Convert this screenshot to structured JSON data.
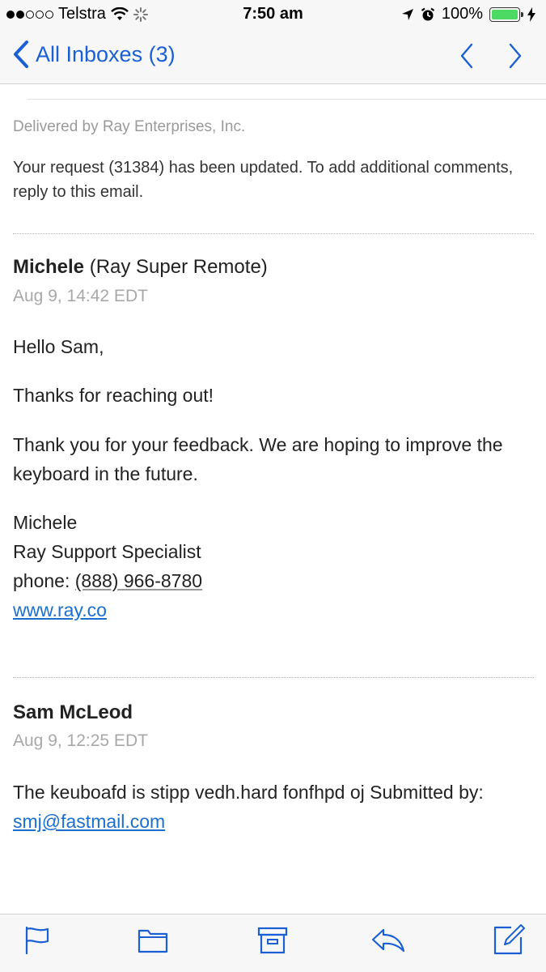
{
  "status_bar": {
    "carrier": "Telstra",
    "time": "7:50 am",
    "battery": "100%"
  },
  "nav": {
    "back_label": "All Inboxes (3)"
  },
  "email": {
    "delivered_by": "Delivered by Ray Enterprises, Inc.",
    "intro": "Your request (31384) has been updated. To add additional comments, reply to this email."
  },
  "messages": [
    {
      "sender_name": "Michele",
      "sender_org": "(Ray Super Remote)",
      "date": "Aug 9, 14:42 EDT",
      "greeting": "Hello Sam,",
      "line1": "Thanks for reaching out!",
      "line2": "Thank you for your feedback. We are hoping to improve the keyboard in the future.",
      "signature_name": "Michele",
      "signature_title": "Ray Support Specialist",
      "phone_label": "phone:",
      "phone": "(888) 966-8780",
      "website": "www.ray.co"
    },
    {
      "sender_name": "Sam McLeod",
      "date": "Aug 9, 12:25 EDT",
      "body_prefix": "The keuboafd is stipp vedh.hard fonfhpd oj Submitted by:",
      "email_link": "smj@fastmail.com"
    }
  ],
  "colors": {
    "accent": "#1a5fd3",
    "link": "#1a6fd0",
    "battery": "#4cd964"
  },
  "icons": [
    "flag-icon",
    "folder-icon",
    "archive-icon",
    "reply-icon",
    "compose-icon"
  ]
}
